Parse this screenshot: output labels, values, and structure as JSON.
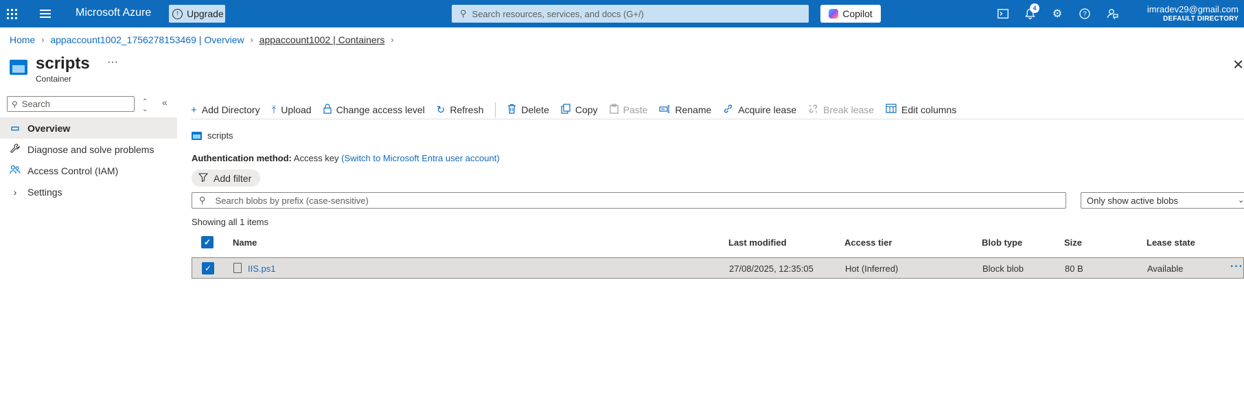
{
  "topbar": {
    "brand": "Microsoft Azure",
    "upgrade_label": "Upgrade",
    "search_placeholder": "Search resources, services, and docs (G+/)",
    "copilot_label": "Copilot",
    "notification_count": "4",
    "account_email": "imradev29@gmail.com",
    "account_directory": "DEFAULT DIRECTORY",
    "accent_color": "#0f6cbd"
  },
  "breadcrumb": {
    "items": [
      "Home",
      "appaccount1002_1756278153469 | Overview",
      "appaccount1002 | Containers"
    ]
  },
  "page": {
    "title": "scripts",
    "subtitle": "Container",
    "more": "···",
    "close": "✕"
  },
  "sidebar": {
    "search_placeholder": "Search",
    "items": [
      {
        "label": "Overview",
        "icon": "container-icon"
      },
      {
        "label": "Diagnose and solve problems",
        "icon": "wrench-icon"
      },
      {
        "label": "Access Control (IAM)",
        "icon": "people-icon"
      },
      {
        "label": "Settings",
        "icon": "chevron-right-icon"
      }
    ]
  },
  "toolbar": {
    "add_directory": "Add Directory",
    "upload": "Upload",
    "change_access": "Change access level",
    "refresh": "Refresh",
    "delete": "Delete",
    "copy": "Copy",
    "paste": "Paste",
    "rename": "Rename",
    "acquire_lease": "Acquire lease",
    "break_lease": "Break lease",
    "edit_columns": "Edit columns"
  },
  "content": {
    "path_label": "scripts",
    "auth_label": "Authentication method:",
    "auth_value": "Access key",
    "auth_link": "(Switch to Microsoft Entra user account)",
    "filter_label": "Add filter",
    "blob_search_placeholder": "Search blobs by prefix (case-sensitive)",
    "filter_select": "Only show active blobs",
    "showing": "Showing all 1 items"
  },
  "table": {
    "columns": [
      "Name",
      "Last modified",
      "Access tier",
      "Blob type",
      "Size",
      "Lease state"
    ],
    "rows": [
      {
        "name": "IIS.ps1",
        "last_modified": "27/08/2025, 12:35:05",
        "access_tier": "Hot (Inferred)",
        "blob_type": "Block blob",
        "size": "80 B",
        "lease_state": "Available",
        "more": "···",
        "selected": true
      }
    ]
  }
}
